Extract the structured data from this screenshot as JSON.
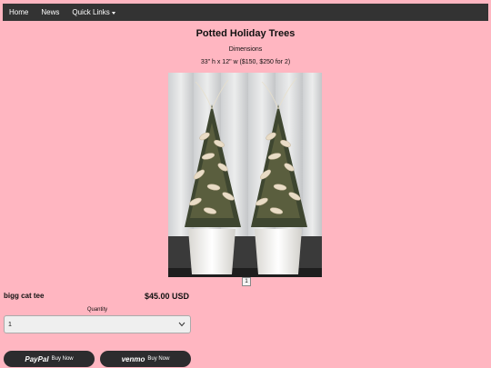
{
  "nav": {
    "items": [
      "Home",
      "News",
      "Quick Links"
    ]
  },
  "product": {
    "title": "Potted Holiday Trees",
    "dimensions_label": "Dimensions",
    "dimensions_value": "33\" h x 12\" w ($150, $250 for 2)",
    "image_alt": "Two potted holiday trees",
    "page_indicator": "1",
    "name": "bigg cat tee",
    "price": "$45.00 USD"
  },
  "quantity": {
    "label": "Quantity",
    "selected": "1"
  },
  "payment": {
    "paypal_brand": "PayPal",
    "paypal_label": "Buy Now",
    "venmo_brand": "venmo",
    "venmo_label": "Buy Now"
  },
  "colors": {
    "background": "#ffb6c1",
    "navbar": "#333333",
    "button": "#2c2c2e"
  }
}
